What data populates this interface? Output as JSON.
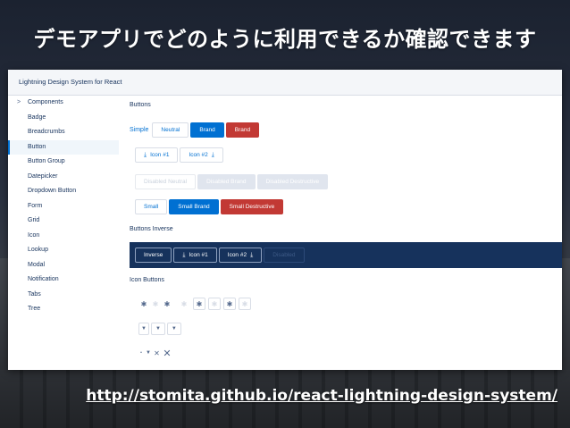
{
  "slide": {
    "headline": "デモアプリでどのように利用できるか確認できます",
    "url": "http://stomita.github.io/react-lightning-design-system/"
  },
  "app": {
    "title": "Lightning Design System for React"
  },
  "sidebar": {
    "items": [
      {
        "label": "Components"
      },
      {
        "label": "Badge"
      },
      {
        "label": "Breadcrumbs"
      },
      {
        "label": "Button"
      },
      {
        "label": "Button Group"
      },
      {
        "label": "Datepicker"
      },
      {
        "label": "Dropdown Button"
      },
      {
        "label": "Form"
      },
      {
        "label": "Grid"
      },
      {
        "label": "Icon"
      },
      {
        "label": "Lookup"
      },
      {
        "label": "Modal"
      },
      {
        "label": "Notification"
      },
      {
        "label": "Tabs"
      },
      {
        "label": "Tree"
      }
    ],
    "active": "Button"
  },
  "buttons": {
    "section_label": "Buttons",
    "row1": {
      "prefix": "Simple",
      "neutral": "Neutral",
      "brand": "Brand",
      "destructive": "Brand"
    },
    "row2": {
      "icon1": "Icon #1",
      "icon2": "Icon #2"
    },
    "row3": {
      "disabled_neutral": "Disabled Neutral",
      "disabled_brand": "Disabled Brand",
      "disabled_destructive": "Disabled Destructive"
    },
    "row4": {
      "small": "Small",
      "small_brand": "Small Brand",
      "small_destructive": "Small Destructive"
    }
  },
  "buttons_inverse": {
    "section_label": "Buttons Inverse",
    "inverse": "Inverse",
    "icon1": "Icon #1",
    "icon2": "Icon #2",
    "disabled": "Disabled"
  },
  "icon_buttons": {
    "section_label": "Icon Buttons"
  },
  "icons": {
    "settings": "settings-icon",
    "download": "download-icon",
    "chevron_down": "chevron-down-icon",
    "close": "close-icon"
  },
  "colors": {
    "brand": "#0070d2",
    "destructive": "#c23934",
    "inverse_bg": "#16325c"
  }
}
